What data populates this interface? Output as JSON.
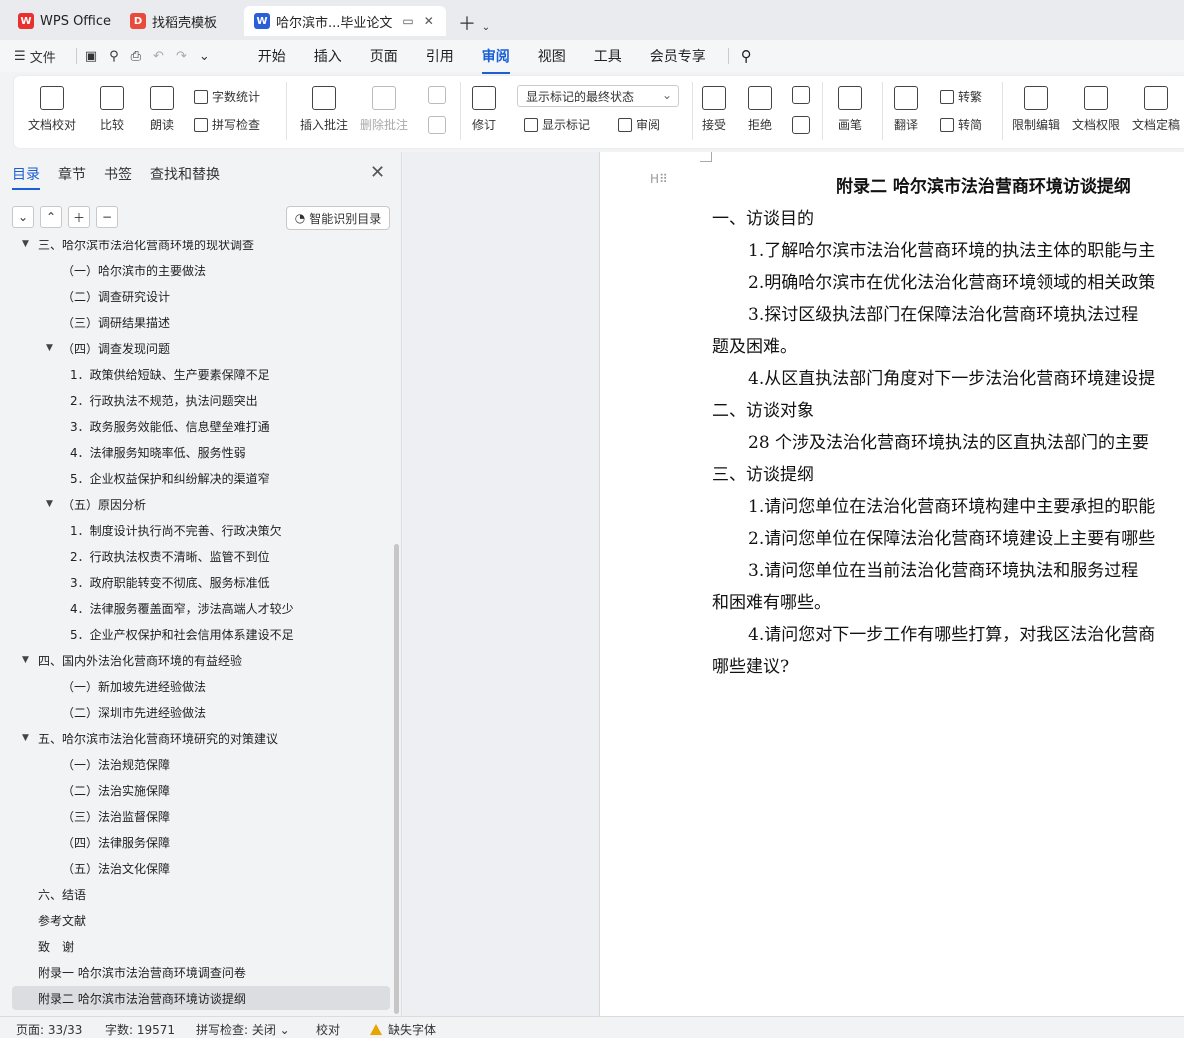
{
  "tabs": [
    {
      "label": "WPS Office",
      "icon": "wps-logo-icon",
      "color": "#e8312f"
    },
    {
      "label": "找稻壳模板",
      "icon": "docer-logo-icon",
      "color": "#e84a3c"
    },
    {
      "label": "哈尔滨市...毕业论文",
      "icon": "word-doc-icon",
      "color": "#2b5fd9"
    }
  ],
  "menu": {
    "file": "文件",
    "items": [
      "开始",
      "插入",
      "页面",
      "引用",
      "审阅",
      "视图",
      "工具",
      "会员专享"
    ],
    "active": "审阅"
  },
  "ribbon": {
    "doc_check": "文档校对",
    "compare": "比较",
    "read_aloud": "朗读",
    "word_count": "字数统计",
    "spell_check": "拼写检查",
    "insert_comment": "插入批注",
    "delete_comment": "删除批注",
    "revise": "修订",
    "markup_dropdown": "显示标记的最终状态",
    "show_markup": "显示标记",
    "review_pane": "审阅",
    "accept": "接受",
    "reject": "拒绝",
    "pen": "画笔",
    "translate": "翻译",
    "to_traditional": "转繁",
    "to_simplified": "转简",
    "restrict_edit": "限制编辑",
    "doc_permission": "文档权限",
    "doc_finalize": "文档定稿"
  },
  "panel": {
    "tabs": [
      "目录",
      "章节",
      "书签",
      "查找和替换"
    ],
    "smart_toc": "智能识别目录",
    "toc": [
      {
        "text": "三、哈尔滨市法治化营商环境的现状调查",
        "level": 1,
        "arrow": true
      },
      {
        "text": "（一）哈尔滨市的主要做法",
        "level": 2
      },
      {
        "text": "（二）调查研究设计",
        "level": 2
      },
      {
        "text": "（三）调研结果描述",
        "level": 2
      },
      {
        "text": "（四）调查发现问题",
        "level": 2,
        "arrow": true
      },
      {
        "text": "1．政策供给短缺、生产要素保障不足",
        "level": 3
      },
      {
        "text": "2．行政执法不规范，执法问题突出",
        "level": 3
      },
      {
        "text": "3．政务服务效能低、信息壁垒难打通",
        "level": 3
      },
      {
        "text": "4．法律服务知晓率低、服务性弱",
        "level": 3
      },
      {
        "text": "5．企业权益保护和纠纷解决的渠道窄",
        "level": 3
      },
      {
        "text": "（五）原因分析",
        "level": 2,
        "arrow": true
      },
      {
        "text": "1．制度设计执行尚不完善、行政决策欠",
        "level": 3
      },
      {
        "text": "2．行政执法权责不清晰、监管不到位",
        "level": 3
      },
      {
        "text": "3．政府职能转变不彻底、服务标准低",
        "level": 3
      },
      {
        "text": "4．法律服务覆盖面窄，涉法高端人才较少",
        "level": 3
      },
      {
        "text": "5．企业产权保护和社会信用体系建设不足",
        "level": 3
      },
      {
        "text": "四、国内外法治化营商环境的有益经验",
        "level": 1,
        "arrow": true
      },
      {
        "text": "（一）新加坡先进经验做法",
        "level": 2
      },
      {
        "text": "（二）深圳市先进经验做法",
        "level": 2
      },
      {
        "text": "五、哈尔滨市法治化营商环境研究的对策建议",
        "level": 1,
        "arrow": true
      },
      {
        "text": "（一）法治规范保障",
        "level": 2
      },
      {
        "text": "（二）法治实施保障",
        "level": 2
      },
      {
        "text": "（三）法治监督保障",
        "level": 2
      },
      {
        "text": "（四）法律服务保障",
        "level": 2
      },
      {
        "text": "（五）法治文化保障",
        "level": 2
      },
      {
        "text": "六、结语",
        "level": 1
      },
      {
        "text": "参考文献",
        "level": 1
      },
      {
        "text": "致　谢",
        "level": 1
      },
      {
        "text": "附录一  哈尔滨市法治营商环境调查问卷",
        "level": 1
      },
      {
        "text": "附录二  哈尔滨市法治营商环境访谈提纲",
        "level": 1,
        "selected": true
      }
    ]
  },
  "document": {
    "title": "附录二  哈尔滨市法治营商环境访谈提纲",
    "lines": [
      "一、访谈目的",
      "1.了解哈尔滨市法治化营商环境的执法主体的职能与主",
      "2.明确哈尔滨市在优化法治化营商环境领域的相关政策",
      "3.探讨区级执法部门在保障法治化营商环境执法过程",
      "题及困难。",
      "4.从区直执法部门角度对下一步法治化营商环境建设提",
      "二、访谈对象",
      "28 个涉及法治化营商环境执法的区直执法部门的主要",
      "三、访谈提纲",
      "1.请问您单位在法治化营商环境构建中主要承担的职能",
      "2.请问您单位在保障法治化营商环境建设上主要有哪些",
      "3.请问您单位在当前法治化营商环境执法和服务过程",
      "和困难有哪些。",
      "4.请问您对下一步工作有哪些打算，对我区法治化营商",
      "哪些建议?"
    ]
  },
  "status": {
    "page": "页面: 33/33",
    "words": "字数: 19571",
    "spell": "拼写检查: 关闭",
    "proof": "校对",
    "missing_font": "缺失字体"
  }
}
